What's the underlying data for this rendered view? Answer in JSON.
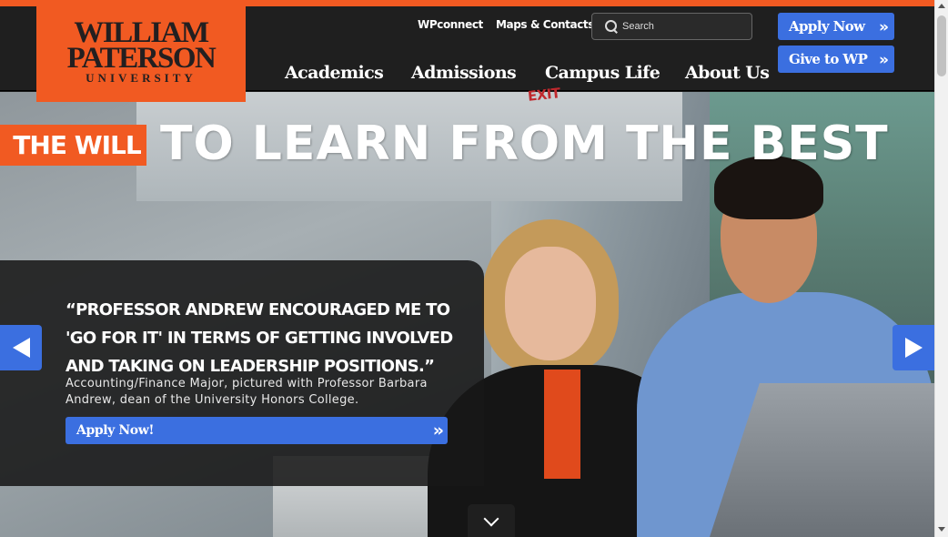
{
  "brand": {
    "logo_line1": "WILLIAM",
    "logo_line2": "PATERSON",
    "logo_line3": "UNIVERSITY",
    "accent_color": "#f15a22",
    "button_color": "#3b6fe0"
  },
  "utility_nav": {
    "wpconnect": "WPconnect",
    "maps": "Maps & Contacts"
  },
  "search": {
    "placeholder": "Search",
    "icon": "search-icon"
  },
  "cta": {
    "apply": "Apply Now",
    "give": "Give to WP",
    "chevron": "»"
  },
  "main_nav": {
    "items": [
      "Academics",
      "Admissions",
      "Campus Life",
      "About Us"
    ]
  },
  "hero": {
    "badge": "THE WILL",
    "tagline": "TO LEARN FROM THE BEST",
    "exit_sign": "EXIT",
    "quote": "“PROFESSOR ANDREW ENCOURAGED ME TO 'GO FOR IT' IN TERMS OF GETTING INVOLVED AND TAKING ON LEADERSHIP POSITIONS.”",
    "caption": "Accounting/Finance Major, pictured with Professor Barbara Andrew, dean of the University Honors College.",
    "apply_button": "Apply Now!",
    "chevron": "»"
  }
}
